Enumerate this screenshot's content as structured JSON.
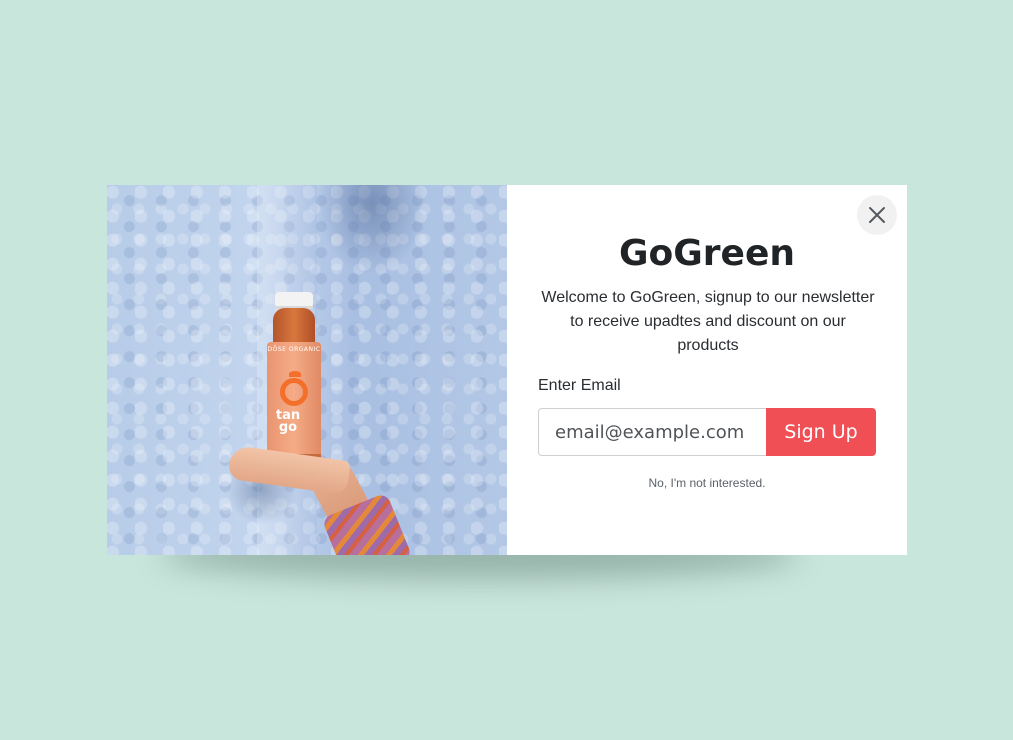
{
  "modal": {
    "title": "GoGreen",
    "intro": "Welcome to GoGreen, signup to our newsletter to receive upadtes and discount on our products",
    "email_label": "Enter Email",
    "email_placeholder": "email@example.com",
    "signup_label": "Sign Up",
    "decline_label": "No, I'm not interested.",
    "close_icon": "close-icon"
  },
  "photo": {
    "bottle_brand": "DÖSE ORGANIC",
    "bottle_flavor": "tan go"
  },
  "colors": {
    "page_background": "#c9e6dc",
    "accent": "#f04f55",
    "title_text": "#212427"
  }
}
